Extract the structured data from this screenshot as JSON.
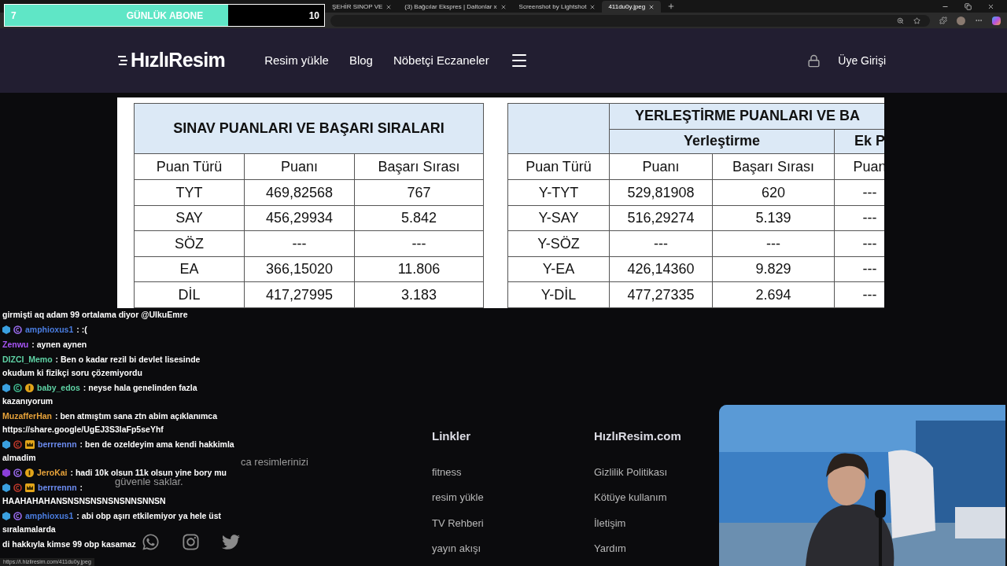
{
  "subscriber_goal": {
    "current": "7",
    "label": "GÜNLÜK ABONE",
    "target": "10",
    "level": 0.7
  },
  "browser": {
    "tabs": [
      {
        "title": "ŞEHİR SINOP VE",
        "selected": false
      },
      {
        "title": "(3) Bağcılar Ekspres | Daltonlar x",
        "selected": false
      },
      {
        "title": "Screenshot by Lightshot",
        "selected": false
      },
      {
        "title": "411du0y.jpeg",
        "selected": true
      }
    ]
  },
  "site": {
    "logo": "HızlıResim",
    "nav": [
      "Resim yükle",
      "Blog",
      "Nöbetçi Eczaneler"
    ],
    "login": "Üye Girişi"
  },
  "image": {
    "left_table": {
      "title": "SINAV PUANLARI VE BAŞARI SIRALARI",
      "columns": [
        "Puan Türü",
        "Puanı",
        "Başarı Sırası"
      ],
      "rows": [
        [
          "TYT",
          "469,82568",
          "767"
        ],
        [
          "SAY",
          "456,29934",
          "5.842"
        ],
        [
          "SÖZ",
          "---",
          "---"
        ],
        [
          "EA",
          "366,15020",
          "11.806"
        ],
        [
          "DİL",
          "417,27995",
          "3.183"
        ]
      ]
    },
    "right_table": {
      "title": "YERLEŞTİRME PUANLARI VE BA",
      "groups": [
        "Yerleştirme",
        "Ek P"
      ],
      "columns": [
        "Puan Türü",
        "Puanı",
        "Başarı Sırası",
        "Puan"
      ],
      "rows": [
        [
          "Y-TYT",
          "529,81908",
          "620",
          "---"
        ],
        [
          "Y-SAY",
          "516,29274",
          "5.139",
          "---"
        ],
        [
          "Y-SÖZ",
          "---",
          "---",
          "---"
        ],
        [
          "Y-EA",
          "426,14360",
          "9.829",
          "---"
        ],
        [
          "Y-DİL",
          "477,27335",
          "2.694",
          "---"
        ]
      ]
    }
  },
  "footer": {
    "description": [
      "ca resimlerinizi",
      "güvenle saklar."
    ],
    "columns": [
      {
        "title": "Linkler",
        "links": [
          "fitness",
          "resim yükle",
          "TV Rehberi",
          "yayın akışı"
        ]
      },
      {
        "title": "HızlıResim.com",
        "links": [
          "Gizlilik Politikası",
          "Kötüye kullanım",
          "İletişim",
          "Yardım"
        ]
      }
    ]
  },
  "chat": [
    {
      "lines": [
        "girmişti aq adam 99 ortalama diyor @UlkuEmre"
      ]
    },
    {
      "user": "amphioxus1",
      "color": "#4a7de0",
      "badges": [
        {
          "kind": "cube"
        },
        {
          "kind": "c_purple"
        }
      ],
      "lines": [
        ": :("
      ]
    },
    {
      "user": "Zenwu",
      "color": "#a855f7",
      "lines": [
        ": aynen aynen"
      ]
    },
    {
      "user": "DIZCI_Memo",
      "color": "#5fd3a5",
      "lines": [
        ": Ben o kadar rezil bi devlet lisesinde",
        "okudum ki fizikçi soru çözemiyordu"
      ]
    },
    {
      "user": "baby_edos",
      "color": "#5fd3a5",
      "badges": [
        {
          "kind": "cube"
        },
        {
          "kind": "c_teal"
        },
        {
          "kind": "one"
        }
      ],
      "lines": [
        ": neyse hala genelinden fazla",
        "kazanıyorum"
      ]
    },
    {
      "user": "MuzafferHan",
      "color": "#e8a33a",
      "lines": [
        ": ben atmıştım sana ztn abim açıklanımca",
        "https://share.google/UgEJ3S3laFp5seYhf"
      ]
    },
    {
      "user": "berrrennn",
      "color": "#6c8cf0",
      "badges": [
        {
          "kind": "cube"
        },
        {
          "kind": "c_red"
        },
        {
          "kind": "crown"
        }
      ],
      "lines": [
        ": ben de ozeldeyim ama kendi hakkimla",
        "almadim"
      ]
    },
    {
      "user": "JeroKai",
      "color": "#e8a33a",
      "badges": [
        {
          "kind": "cube_purple"
        },
        {
          "kind": "c_purple"
        },
        {
          "kind": "one"
        }
      ],
      "lines": [
        ": hadi 10k olsun 11k olsun yine bory mu"
      ]
    },
    {
      "user": "berrrennn",
      "color": "#6c8cf0",
      "badges": [
        {
          "kind": "cube"
        },
        {
          "kind": "c_red"
        },
        {
          "kind": "crown"
        }
      ],
      "lines": [
        ":",
        "HAAHAHAHANSNSNSNSNSNSNNSNNSN"
      ]
    },
    {
      "user": "amphioxus1",
      "color": "#4a7de0",
      "badges": [
        {
          "kind": "cube"
        },
        {
          "kind": "c_purple"
        }
      ],
      "lines": [
        ": abi obp aşırı etkilemiyor ya hele üst",
        "sıralamalarda"
      ]
    },
    {
      "lines": [
        "di hakkıyla kimse 99 obp kasamaz"
      ]
    }
  ],
  "status_url": "https://i.hizliresim.com/411du0y.jpeg"
}
